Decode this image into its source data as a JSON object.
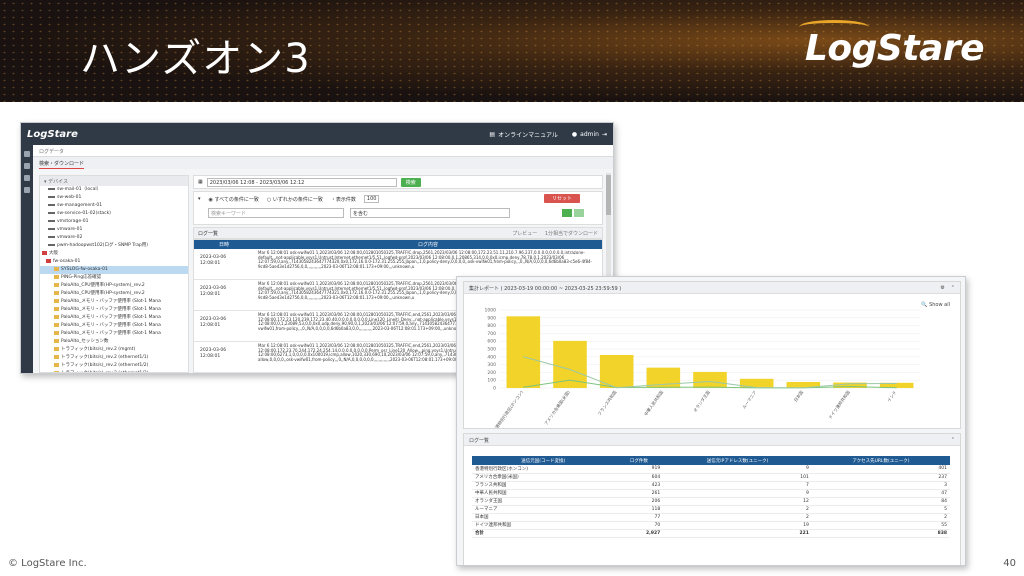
{
  "slide": {
    "title": "ハンズオン3",
    "logo": "LogStare",
    "footer_left": "© LogStare Inc.",
    "footer_right": "40"
  },
  "app": {
    "logo": "LogStare",
    "topbar": {
      "manual": "オンラインマニュアル",
      "user": "admin"
    },
    "breadcrumb": "ログデータ",
    "tab": "検索・ダウンロード",
    "tree_header": "デバイス",
    "tree_items": [
      {
        "label": "sw-mail-01（local）",
        "kind": "dev",
        "indent": 8,
        "selected": false
      },
      {
        "label": "sw-web-01",
        "kind": "dev",
        "indent": 8,
        "selected": false
      },
      {
        "label": "sw-management-01",
        "kind": "dev",
        "indent": 8,
        "selected": false
      },
      {
        "label": "sw-service-01-02(stack)",
        "kind": "dev",
        "indent": 8,
        "selected": false
      },
      {
        "label": "vmstorage-01",
        "kind": "dev",
        "indent": 8,
        "selected": false
      },
      {
        "label": "vmware-01",
        "kind": "dev",
        "indent": 8,
        "selected": false
      },
      {
        "label": "vmware-02",
        "kind": "dev",
        "indent": 8,
        "selected": false
      },
      {
        "label": "pwm-hadoopwst102(ログ・SNMP Trap用)",
        "kind": "dev",
        "indent": 8,
        "selected": false
      },
      {
        "label": "大阪",
        "kind": "fw",
        "indent": 2,
        "selected": false
      },
      {
        "label": "fw-osaka-01",
        "kind": "fw",
        "indent": 6,
        "selected": false
      },
      {
        "label": "SYSLOG-fw-osaka-01",
        "kind": "fold",
        "indent": 14,
        "selected": true
      },
      {
        "label": "PING-Ping応答確認",
        "kind": "fold",
        "indent": 14,
        "selected": false
      },
      {
        "label": "PaloAlto_CPU使用率(HP-system)_rev.2",
        "kind": "fold",
        "indent": 14,
        "selected": false
      },
      {
        "label": "PaloAlto_CPU使用率(HP-system)_rev.2",
        "kind": "fold",
        "indent": 14,
        "selected": false
      },
      {
        "label": "PaloAlto_メモリ・バッファ使用率 (Slot-1 Mana",
        "kind": "fold",
        "indent": 14,
        "selected": false
      },
      {
        "label": "PaloAlto_メモリ・バッファ使用率 (Slot-1 Mana",
        "kind": "fold",
        "indent": 14,
        "selected": false
      },
      {
        "label": "PaloAlto_メモリ・バッファ使用率 (Slot-1 Mana",
        "kind": "fold",
        "indent": 14,
        "selected": false
      },
      {
        "label": "PaloAlto_メモリ・バッファ使用率 (Slot-1 Mana",
        "kind": "fold",
        "indent": 14,
        "selected": false
      },
      {
        "label": "PaloAlto_メモリ・バッファ使用率 (Slot-1 Mana",
        "kind": "fold",
        "indent": 14,
        "selected": false
      },
      {
        "label": "PaloAlto_セッション数",
        "kind": "fold",
        "indent": 14,
        "selected": false
      },
      {
        "label": "トラフィック(bits/s)_rev.2 (mgmt)",
        "kind": "fold",
        "indent": 14,
        "selected": false
      },
      {
        "label": "トラフィック(bits/s)_rev.2 (ethernet1/1)",
        "kind": "fold",
        "indent": 14,
        "selected": false
      },
      {
        "label": "トラフィック(bits/s)_rev.2 (ethernet1/2)",
        "kind": "fold",
        "indent": 14,
        "selected": false
      },
      {
        "label": "トラフィック(bits/s)_rev.2 (ethernet1/3)",
        "kind": "fold",
        "indent": 14,
        "selected": false
      },
      {
        "label": "トラフィック(bits/s)_rev.2 (ethernet1/4)",
        "kind": "fold",
        "indent": 14,
        "selected": false
      }
    ],
    "search": {
      "range": "2023/03/06 12:08 - 2023/03/06 12:12",
      "button": "検索"
    },
    "filters": {
      "all_cond": "すべての条件に一致",
      "any_cond": "いずれかの条件に一致",
      "show_count_label": "・表示件数",
      "show_count": "100",
      "reset": "リセット",
      "keyword_placeholder": "検索キーワード",
      "match": "を含む"
    },
    "log_list_title": "ログ一覧",
    "log_tabs": [
      "プレビュー",
      "1分相当でダウンロード"
    ],
    "log_headers": [
      "日時",
      "ログ内容"
    ],
    "log_rows": [
      {
        "date": "2023-03-06",
        "time": "12:08:01",
        "msg": "Mar 6 12:08:01 osk-vwifw01 1,2023/03/06 12:08:00,012801050325,TRAFFIC,drop,2561,2023/03/06 12:08:00,172.23.51.11,210.7.96.237,0.0.0.0,0.0.0.0,intrazone-default,,,not-applicable,vsys1,Untrust,Internet,ethernet1/5.51,,logfwd-prof,2023/03/06 12:08:00,0,1,20865,314,0,0,0x0,icmp,deny,78,78,0,1,2023/03/06 12:07:59,0,any,,7143058243647774320,0x0,172,16.0.0-172.31.255.255,Japan,,1,0,policy-deny,0,0,0,0,,osk-vwifw01,from-policy,,,0,,N/A,0,0,0,0,6d6b0a83-c5e6-4f84-9cd8-5ae43e1d2756,0,0,,,,,,,,,,,2023-03-06T12:08:01.173+09:00,,,unknown,u"
      },
      {
        "date": "2023-03-06",
        "time": "12:08:01",
        "msg": "Mar 6 12:08:01 osk-vwifw01 1,2023/03/06 12:08:00,012801050325,TRAFFIC,drop,2561,2023/03/06 12:08:00,172.23.51.11,210.7.96.237,0.0.0.0,0.0.0.0,intrazone-default,,,not-applicable,vsys1,Untrust,Internet,ethernet1/5.51,,logfwd-prof,2023/03/06 12:08:00,0,1,20866,314,0,0,0x0,icmp,deny,78,78,0,1,2023/03/06 12:07:59,0,any,,7143058243647774321,0x0,172,16.0.0-172.31.255.255,Japan,,1,0,policy-deny,0,0,0,0,,osk-vwifw01,from-policy,,,0,,N/A,0,0,0,0,6d6b0a83-c5e6-4f84-9cd8-5ae43e1d2756,0,0,,,,,,,,,,,2023-03-06T12:08:01.173+09:00,,,unknown,u"
      },
      {
        "date": "2023-03-06",
        "time": "12:08:01",
        "msg": "Mar 6 12:08:01 osk-vwifw01 1,2023/03/06 12:08:00,012801050325,TRAFFIC,end,2561,2023/03/06 12:08:00,172.23.120.239,172.23.40.40,0.0.0.0,0.0.0.0,Line120_Lineiti_Deny,,,not-applicable,vsys1,Untrust,Internet,ethernet1/5.51,,logfwd-prof,2023/03/06 12:08:00,0,1,23089,53,0,0,0x0,udp,deny,90,90,0,1,2023/03/06 12:07:59,0,any,,7143058243647774322,0x0,172.31.255.255,Japan,,1,0,policy-deny,0,0,0,0,,osk-vwifw01,from-policy,,,0,,N/A,0,0,0,0,6d6b0a83,0,0,,,,,,,,,,,2023-03-06T12:08:01.173+09:00,,,unknown,u"
      },
      {
        "date": "2023-03-06",
        "time": "12:08:01",
        "msg": "Mar 6 12:08:01 osk-vwifw01 1,2023/03/06 12:08:00,012801050325,TRAFFIC,end,2561,2023/03/06 12:08:00,172.23.70.244,172.24.254.14,0.0.0.0,0.0.0.0,Perm_osr_Line120_Allow,,,ping,vsys1,Untrust,Internet,ethernet1/5.51,,logfwd-prof,2023/03/06 12:08:00,6273,1,0,0,0,0,0x100019,icmp,allow,1020,330,690,10,2023/03/06 12:07:59,0,any,,7143058243647774323,0x0,172.31.255.255,Japan,,1,0,policy-allow,0,0,0,0,,osk-vwifw01,from-policy,,,0,,N/A,0,0,0,0,0,0,,,,,,,,,,,,,2023-03-06T12:08:01.173+09:00,,,unknown,u"
      },
      {
        "date": "2023-03-06",
        "time": "12:08:01",
        "msg": "Mar 6 12:08:01 osk-vwifw01 1,2023/03/06 12:08:00,012801050325,TRAFFIC,end,2561,2023/03/06 12:08:00,172.23.70.244,172.24.254.14,0.0.0.0,0.0.0.0,Perm_osr_Line120_Allow,,,ping,vsys1,Untrust,Internet,ethernet1/5.51,,logfwd-prof,2023/03/06 12:08:00,6273,1,0,0,0,0,0x100019,icmp,allow,1020,330,690,10,2023/03/06 12:07:59,0,any,,7143058243647774324,0x0,vulnerability,tunnel-other-application,per-appver-ueil,,unkummbed,no,no,0"
      }
    ]
  },
  "report": {
    "report_title": "集計レポート ( 2023-03-19 00:00:00 ~ 2023-03-25 23:59:59 )",
    "show_all": "Show all",
    "list_title": "ログ一覧",
    "table_headers": [
      "送信元国(コード変換)",
      "ログ件数",
      "送信元IPアドレス数(ユニーク)",
      "アクセス先URL数(ユニーク)"
    ],
    "table_rows": [
      [
        "香港特別行政区(ホンコン)",
        "919",
        "9",
        "401"
      ],
      [
        "アメリカ合衆国(米国)",
        "604",
        "101",
        "237"
      ],
      [
        "フランス共和国",
        "423",
        "7",
        "3"
      ],
      [
        "中華人民共和国",
        "261",
        "9",
        "47"
      ],
      [
        "オランダ王国",
        "206",
        "12",
        "84"
      ],
      [
        "ルーマニア",
        "118",
        "2",
        "5"
      ],
      [
        "日本国",
        "77",
        "2",
        "2"
      ],
      [
        "ドイツ連邦共和国",
        "70",
        "19",
        "55"
      ]
    ],
    "total": [
      "合計",
      "2,927",
      "221",
      "838"
    ]
  },
  "chart_data": {
    "type": "bar",
    "title": "",
    "ylim": [
      0,
      1000
    ],
    "yticks": [
      0,
      100,
      200,
      300,
      400,
      500,
      600,
      700,
      800,
      900,
      1000
    ],
    "categories": [
      "香港特別行政区(ホンコン)",
      "アメリカ合衆国(米国)",
      "フランス共和国",
      "中華人民共和国",
      "オランダ王国",
      "ルーマニア",
      "日本国",
      "ドイツ連邦共和国",
      "インド"
    ],
    "series": [
      {
        "values": [
          919,
          604,
          423,
          261,
          206,
          118,
          77,
          70,
          67
        ],
        "color": "#f2d32a",
        "kind": "bar"
      },
      {
        "values": [
          9,
          101,
          7,
          9,
          12,
          2,
          2,
          19,
          3
        ],
        "color": "#7cc47c",
        "kind": "line"
      },
      {
        "values": [
          401,
          237,
          3,
          47,
          84,
          5,
          2,
          55,
          58
        ],
        "color": "#9bc9a8",
        "kind": "line"
      }
    ],
    "bar_color": "#f2d32a"
  }
}
